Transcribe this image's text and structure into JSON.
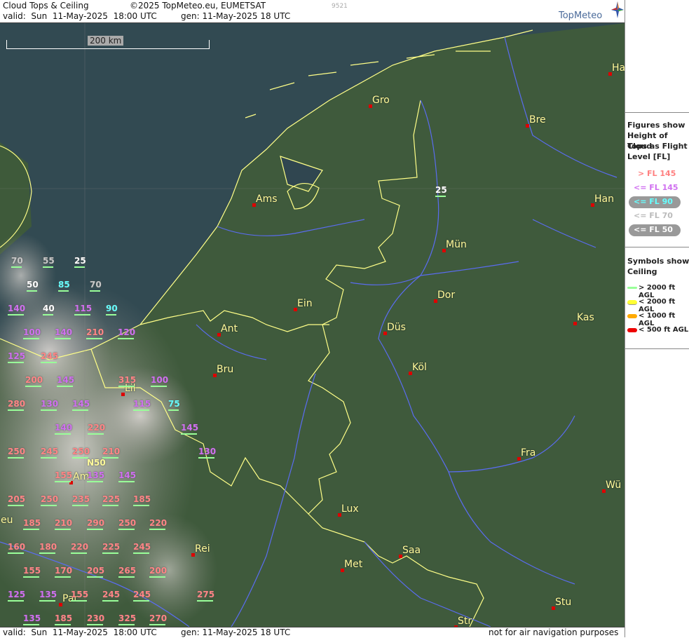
{
  "header": {
    "title": "Cloud Tops & Ceiling",
    "copyright": "©2025 TopMeteo.eu, EUMETSAT",
    "code": "9521",
    "valid": "valid:  Sun  11-May-2025  18:00 UTC",
    "gen": "gen: 11-May-2025 18 UTC",
    "logo": "TopMeteo"
  },
  "footer": {
    "valid": "valid:  Sun  11-May-2025  18:00 UTC",
    "gen": "gen: 11-May-2025 18 UTC",
    "note": "not for air navigation purposes"
  },
  "scale": {
    "label": "200 km"
  },
  "legend_figures": {
    "heading": [
      "Figures show",
      "Height of Cloud",
      "Tops as Flight",
      "Level  [FL]"
    ],
    "items": [
      {
        "label": "> FL 145",
        "color": "#ff7f7f"
      },
      {
        "label": "<= FL 145",
        "color": "#d070f0"
      },
      {
        "label": "<= FL 90",
        "color": "#66ffff"
      },
      {
        "label": "<= FL 70",
        "color": "#bbbbbb"
      },
      {
        "label": "<= FL 50",
        "color": "#ffffff"
      }
    ]
  },
  "legend_symbols": {
    "heading": [
      "Symbols show",
      "Ceiling"
    ],
    "items": [
      {
        "label": "> 2000 ft AGL",
        "color": "#99ff99"
      },
      {
        "label": "< 2000 ft AGL",
        "color": "#ffff33"
      },
      {
        "label": "< 1000 ft AGL",
        "color": "#ffaa00"
      },
      {
        "label": "< 500 ft AGL",
        "color": "#ee0000"
      }
    ]
  },
  "cities": [
    {
      "name": "Gro"
    },
    {
      "name": "Bre"
    },
    {
      "name": "Ha"
    },
    {
      "name": "Ams"
    },
    {
      "name": "Han"
    },
    {
      "name": "Mün"
    },
    {
      "name": "Dor"
    },
    {
      "name": "Ein"
    },
    {
      "name": "Ant"
    },
    {
      "name": "Düs"
    },
    {
      "name": "Kas"
    },
    {
      "name": "Bru"
    },
    {
      "name": "Köl"
    },
    {
      "name": "Lil"
    },
    {
      "name": "Fra"
    },
    {
      "name": "Am"
    },
    {
      "name": "Wü"
    },
    {
      "name": "Lux"
    },
    {
      "name": "Rei"
    },
    {
      "name": "Saa"
    },
    {
      "name": "Met"
    },
    {
      "name": "Stu"
    },
    {
      "name": "Par"
    },
    {
      "name": "Str"
    },
    {
      "name": "eu"
    }
  ],
  "cloud_tops": [
    {
      "value": "25",
      "cat": "white"
    },
    {
      "value": "70",
      "cat": "grey"
    },
    {
      "value": "55",
      "cat": "grey"
    },
    {
      "value": "25",
      "cat": "white"
    },
    {
      "value": "50",
      "cat": "white"
    },
    {
      "value": "85",
      "cat": "cyan"
    },
    {
      "value": "70",
      "cat": "grey"
    },
    {
      "value": "140",
      "cat": "purple"
    },
    {
      "value": "40",
      "cat": "white"
    },
    {
      "value": "115",
      "cat": "purple"
    },
    {
      "value": "90",
      "cat": "cyan"
    },
    {
      "value": "100",
      "cat": "purple"
    },
    {
      "value": "140",
      "cat": "purple"
    },
    {
      "value": "210",
      "cat": "red"
    },
    {
      "value": "120",
      "cat": "purple"
    },
    {
      "value": "125",
      "cat": "purple"
    },
    {
      "value": "245",
      "cat": "red"
    },
    {
      "value": "200",
      "cat": "red"
    },
    {
      "value": "145",
      "cat": "purple"
    },
    {
      "value": "315",
      "cat": "red"
    },
    {
      "value": "100",
      "cat": "purple"
    },
    {
      "value": "280",
      "cat": "red"
    },
    {
      "value": "130",
      "cat": "purple"
    },
    {
      "value": "145",
      "cat": "purple"
    },
    {
      "value": "115",
      "cat": "purple"
    },
    {
      "value": "75",
      "cat": "cyan"
    },
    {
      "value": "140",
      "cat": "purple"
    },
    {
      "value": "220",
      "cat": "red"
    },
    {
      "value": "145",
      "cat": "purple"
    },
    {
      "value": "250",
      "cat": "red"
    },
    {
      "value": "245",
      "cat": "red"
    },
    {
      "value": "250",
      "cat": "red"
    },
    {
      "value": "210",
      "cat": "red"
    },
    {
      "value": "130",
      "cat": "purple"
    },
    {
      "value": "N50",
      "cat": "white"
    },
    {
      "value": "155",
      "cat": "red"
    },
    {
      "value": "135",
      "cat": "purple"
    },
    {
      "value": "145",
      "cat": "purple"
    },
    {
      "value": "205",
      "cat": "red"
    },
    {
      "value": "250",
      "cat": "red"
    },
    {
      "value": "235",
      "cat": "red"
    },
    {
      "value": "225",
      "cat": "red"
    },
    {
      "value": "185",
      "cat": "red"
    },
    {
      "value": "185",
      "cat": "red"
    },
    {
      "value": "210",
      "cat": "red"
    },
    {
      "value": "290",
      "cat": "red"
    },
    {
      "value": "250",
      "cat": "red"
    },
    {
      "value": "220",
      "cat": "red"
    },
    {
      "value": "160",
      "cat": "red"
    },
    {
      "value": "180",
      "cat": "red"
    },
    {
      "value": "220",
      "cat": "red"
    },
    {
      "value": "225",
      "cat": "red"
    },
    {
      "value": "245",
      "cat": "red"
    },
    {
      "value": "155",
      "cat": "red"
    },
    {
      "value": "170",
      "cat": "red"
    },
    {
      "value": "205",
      "cat": "red"
    },
    {
      "value": "265",
      "cat": "red"
    },
    {
      "value": "200",
      "cat": "red"
    },
    {
      "value": "125",
      "cat": "purple"
    },
    {
      "value": "135",
      "cat": "purple"
    },
    {
      "value": "155",
      "cat": "red"
    },
    {
      "value": "245",
      "cat": "red"
    },
    {
      "value": "245",
      "cat": "red"
    },
    {
      "value": "275",
      "cat": "red"
    },
    {
      "value": "135",
      "cat": "purple"
    },
    {
      "value": "185",
      "cat": "red"
    },
    {
      "value": "230",
      "cat": "red"
    },
    {
      "value": "325",
      "cat": "red"
    },
    {
      "value": "270",
      "cat": "red"
    }
  ]
}
